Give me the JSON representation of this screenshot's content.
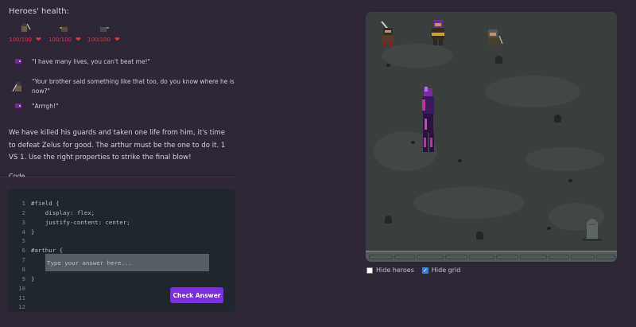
{
  "heroes": {
    "title": "Heroes' health:",
    "list": [
      {
        "name": "fighter",
        "hp": "100/100"
      },
      {
        "name": "archer",
        "hp": "100/100"
      },
      {
        "name": "rogue",
        "hp": "100/100"
      }
    ]
  },
  "dialog": [
    {
      "speaker": "zelus",
      "text": "\"I have many lives, you can't beat me!\""
    },
    {
      "speaker": "hero",
      "text": "\"Your brother said something like that too, do you know where he is now?\""
    },
    {
      "speaker": "zelus",
      "text": "\"Arrrgh!\""
    }
  ],
  "story": "We have killed his guards and taken one life from him, it's time to defeat Zelus for good. The arthur must be the one to do it. 1 VS 1. Use the right properties to strike the final blow!",
  "cut_heading": "Code",
  "editor": {
    "line_numbers": [
      "1",
      "2",
      "3",
      "4",
      "5",
      "6",
      "7",
      "8",
      "9",
      "10",
      "11",
      "12"
    ],
    "lines": [
      "#field {",
      "    display: flex;",
      "    justify-content: center;",
      "}",
      "",
      "#arthur {",
      "",
      "",
      "}"
    ],
    "answer_placeholder": "Type your answer here...",
    "check_label": "Check Answer"
  },
  "board": {
    "hide_heroes_label": "Hide heroes",
    "hide_heroes_checked": false,
    "hide_grid_label": "Hide grid",
    "hide_grid_checked": true
  },
  "colors": {
    "background": "#2f2737",
    "accent": "#7b2fe0",
    "health": "#d23b4a",
    "editor_bg": "#20262e",
    "board_bg": "#3a3f3e"
  }
}
